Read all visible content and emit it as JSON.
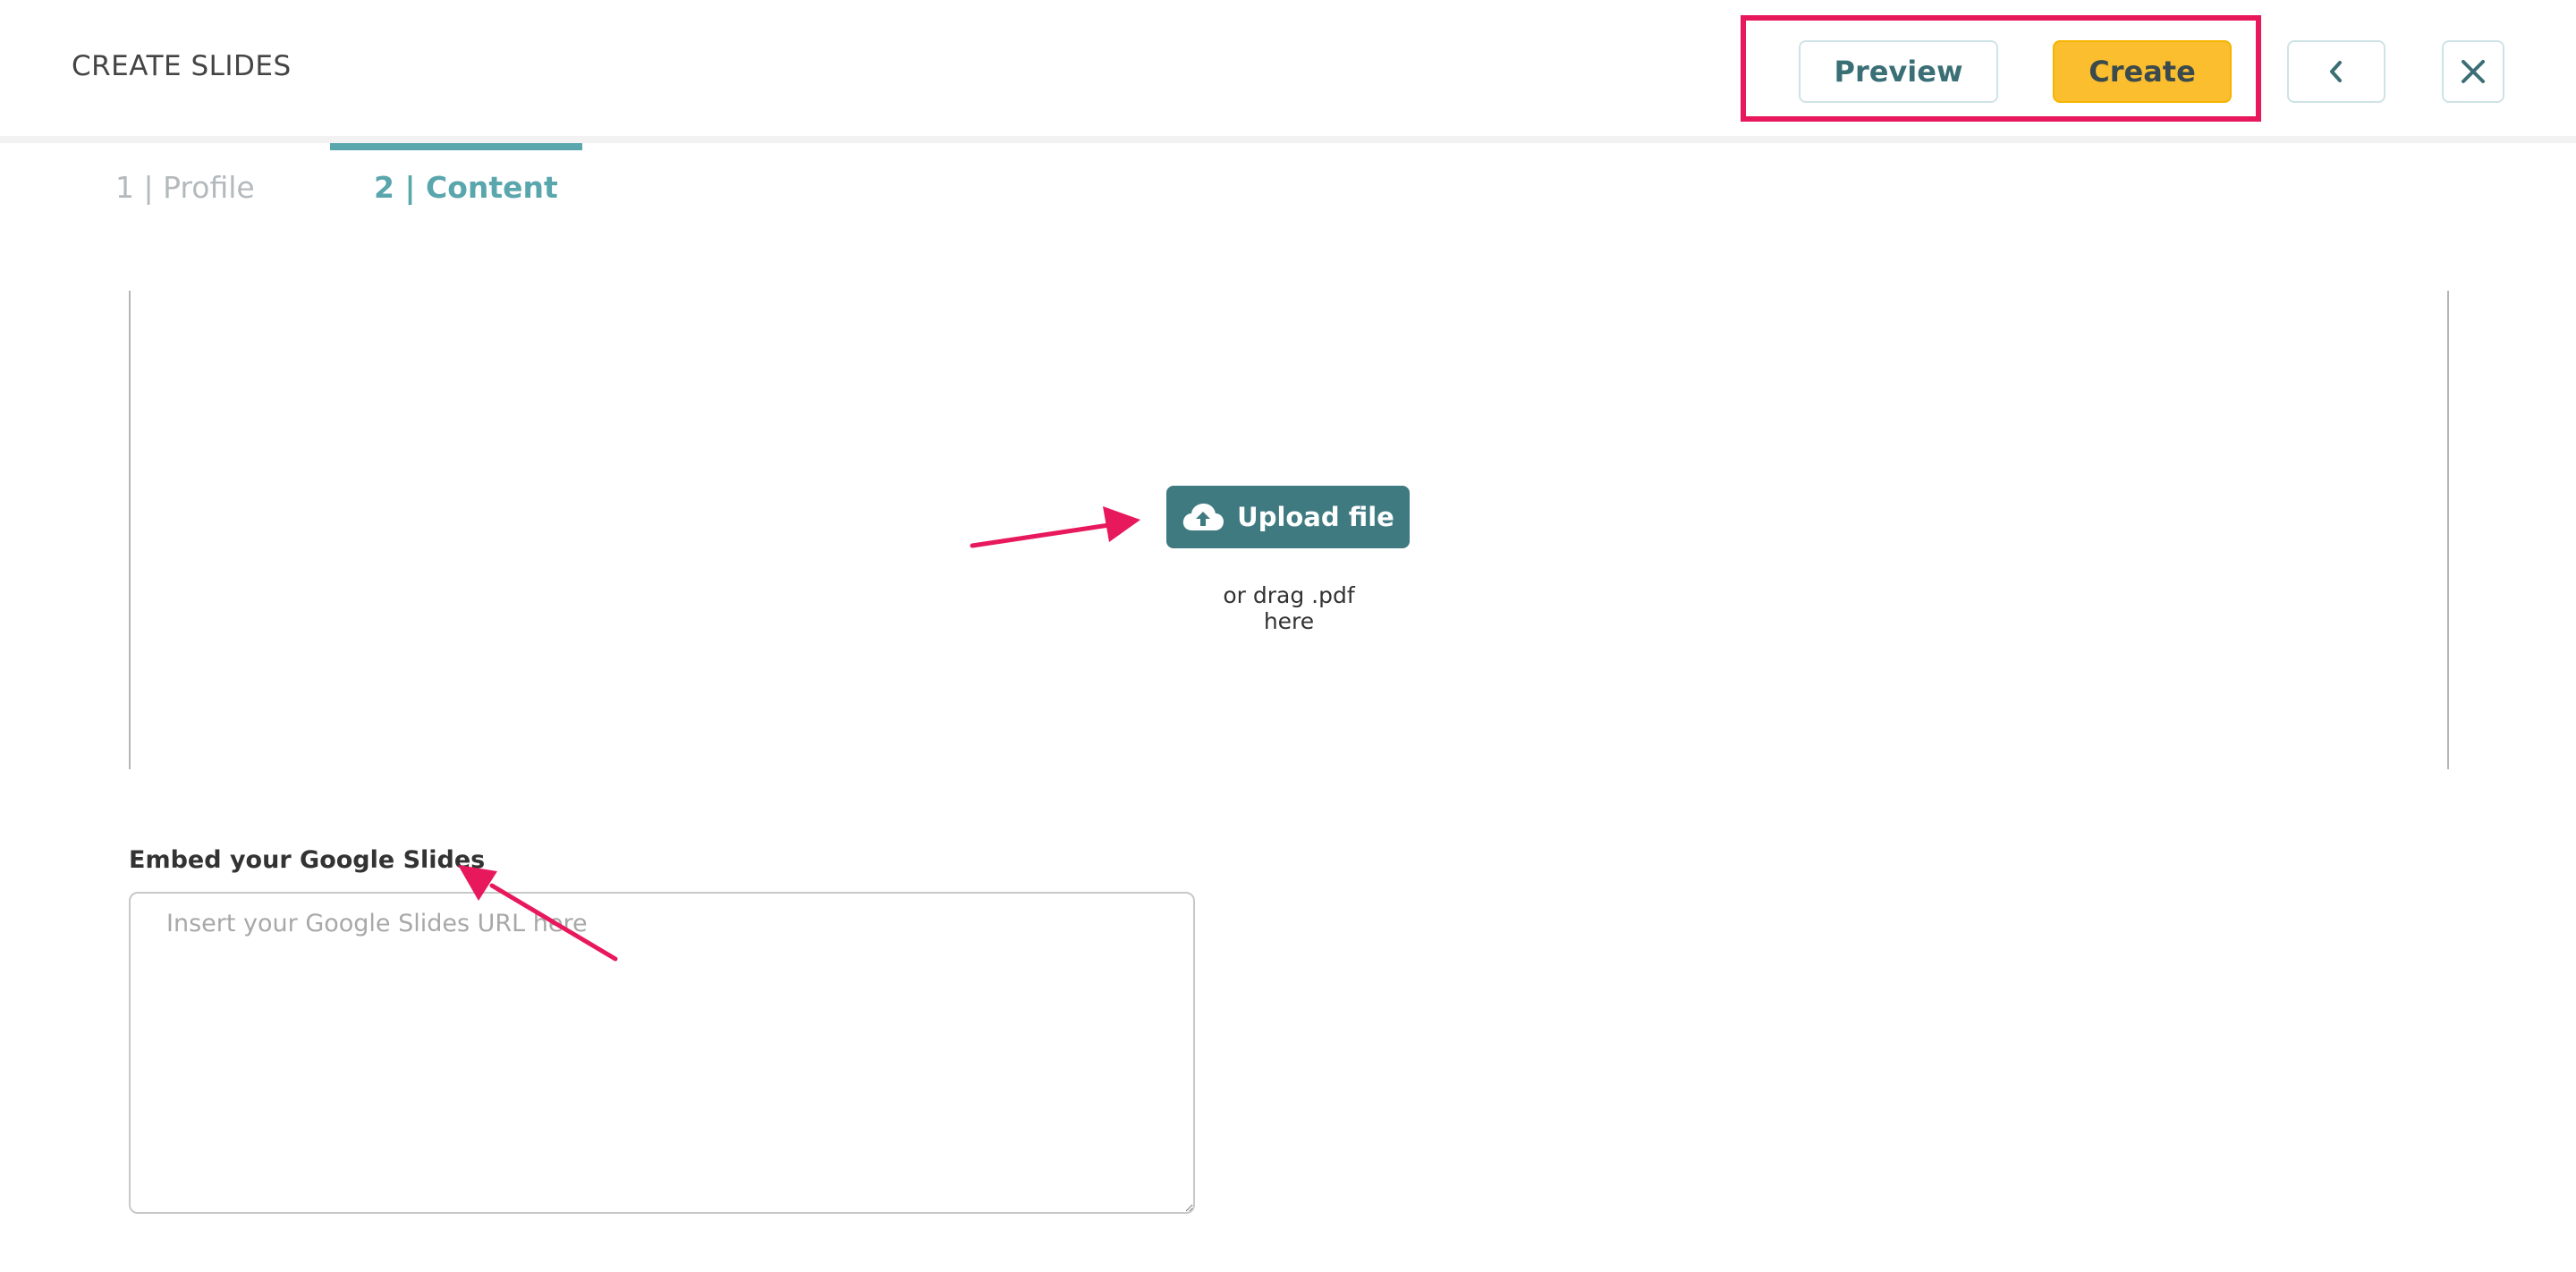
{
  "header": {
    "title": "CREATE SLIDES",
    "preview_label": "Preview",
    "create_label": "Create"
  },
  "tabs": [
    {
      "label": "1 | Profile",
      "active": false
    },
    {
      "label": "2 | Content",
      "active": true
    }
  ],
  "upload": {
    "button_label": "Upload file",
    "hint": "or drag .pdf here"
  },
  "embed": {
    "label": "Embed your Google Slides",
    "placeholder": "Insert your Google Slides URL here",
    "value": ""
  },
  "colors": {
    "accent": "#5aa6ad",
    "primary_button": "#3e7a80",
    "create_button": "#fbbe2e",
    "annotation": "#e8185d"
  },
  "icons": {
    "back": "chevron-left-icon",
    "close": "close-icon",
    "upload": "cloud-upload-icon"
  }
}
